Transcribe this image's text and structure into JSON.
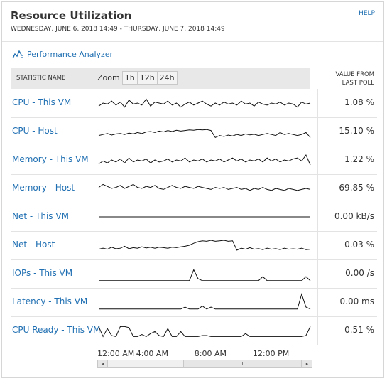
{
  "header": {
    "title": "Resource Utilization",
    "subtitle": "WEDNESDAY, JUNE 6, 2018 14:49 - THURSDAY, JUNE 7, 2018 14:49",
    "help": "HELP"
  },
  "perf_link": "Performance Analyzer",
  "table_header": {
    "statistic": "STATISTIC NAME",
    "zoom_label": "Zoom",
    "zoom_options": [
      "1h",
      "12h",
      "24h"
    ],
    "value_line1": "VALUE FROM",
    "value_line2": "LAST POLL"
  },
  "rows": [
    {
      "label": "CPU - This VM",
      "value": "1.08 %",
      "series": [
        0.35,
        0.5,
        0.45,
        0.6,
        0.4,
        0.55,
        0.3,
        0.65,
        0.45,
        0.5,
        0.4,
        0.7,
        0.35,
        0.55,
        0.5,
        0.45,
        0.6,
        0.4,
        0.5,
        0.3,
        0.45,
        0.55,
        0.4,
        0.5,
        0.6,
        0.45,
        0.35,
        0.5,
        0.4,
        0.55,
        0.45,
        0.5,
        0.4,
        0.6,
        0.45,
        0.5,
        0.35,
        0.55,
        0.45,
        0.4,
        0.5,
        0.45,
        0.55,
        0.4,
        0.5,
        0.45,
        0.3,
        0.55,
        0.45,
        0.5
      ]
    },
    {
      "label": "CPU - Host",
      "value": "15.10 %",
      "series": [
        0.3,
        0.35,
        0.4,
        0.32,
        0.38,
        0.4,
        0.35,
        0.42,
        0.38,
        0.45,
        0.4,
        0.48,
        0.5,
        0.45,
        0.52,
        0.48,
        0.55,
        0.5,
        0.56,
        0.52,
        0.55,
        0.58,
        0.56,
        0.6,
        0.58,
        0.6,
        0.55,
        0.2,
        0.3,
        0.25,
        0.32,
        0.28,
        0.35,
        0.3,
        0.38,
        0.33,
        0.36,
        0.3,
        0.35,
        0.4,
        0.35,
        0.3,
        0.45,
        0.35,
        0.4,
        0.35,
        0.3,
        0.35,
        0.45,
        0.2
      ]
    },
    {
      "label": "Memory - This VM",
      "value": "1.22 %",
      "series": [
        0.3,
        0.45,
        0.35,
        0.5,
        0.4,
        0.55,
        0.35,
        0.6,
        0.4,
        0.5,
        0.45,
        0.55,
        0.35,
        0.5,
        0.4,
        0.45,
        0.55,
        0.4,
        0.5,
        0.45,
        0.6,
        0.4,
        0.5,
        0.45,
        0.55,
        0.4,
        0.5,
        0.45,
        0.55,
        0.4,
        0.5,
        0.6,
        0.45,
        0.55,
        0.4,
        0.5,
        0.45,
        0.55,
        0.4,
        0.6,
        0.45,
        0.55,
        0.4,
        0.5,
        0.45,
        0.55,
        0.6,
        0.45,
        0.75,
        0.25
      ]
    },
    {
      "label": "Memory - Host",
      "value": "69.85 %",
      "series": [
        0.55,
        0.7,
        0.6,
        0.5,
        0.55,
        0.65,
        0.5,
        0.6,
        0.7,
        0.55,
        0.5,
        0.6,
        0.55,
        0.65,
        0.5,
        0.45,
        0.55,
        0.65,
        0.55,
        0.5,
        0.6,
        0.55,
        0.5,
        0.6,
        0.55,
        0.5,
        0.45,
        0.55,
        0.5,
        0.55,
        0.45,
        0.5,
        0.55,
        0.45,
        0.5,
        0.4,
        0.5,
        0.45,
        0.55,
        0.45,
        0.4,
        0.5,
        0.45,
        0.4,
        0.5,
        0.45,
        0.4,
        0.45,
        0.5,
        0.45
      ]
    },
    {
      "label": "Net - This VM",
      "value": "0.00 kB/s",
      "series": [
        0.5,
        0.5,
        0.5,
        0.5,
        0.5,
        0.5,
        0.5,
        0.5,
        0.5,
        0.5,
        0.5,
        0.5,
        0.5,
        0.5,
        0.5,
        0.5,
        0.5,
        0.5,
        0.5,
        0.5,
        0.5,
        0.5,
        0.5,
        0.5,
        0.5,
        0.5,
        0.5,
        0.5,
        0.5,
        0.5,
        0.5,
        0.5,
        0.5,
        0.5,
        0.5,
        0.5,
        0.5,
        0.5,
        0.5,
        0.5,
        0.5,
        0.5,
        0.5,
        0.5,
        0.5,
        0.5,
        0.5,
        0.5,
        0.5,
        0.5
      ]
    },
    {
      "label": "Net - Host",
      "value": "0.03 %",
      "series": [
        0.3,
        0.35,
        0.3,
        0.4,
        0.32,
        0.35,
        0.45,
        0.33,
        0.38,
        0.35,
        0.42,
        0.36,
        0.4,
        0.35,
        0.4,
        0.38,
        0.35,
        0.4,
        0.38,
        0.42,
        0.45,
        0.5,
        0.6,
        0.68,
        0.72,
        0.7,
        0.75,
        0.7,
        0.72,
        0.75,
        0.7,
        0.72,
        0.25,
        0.35,
        0.3,
        0.38,
        0.3,
        0.33,
        0.28,
        0.35,
        0.3,
        0.33,
        0.28,
        0.35,
        0.3,
        0.32,
        0.3,
        0.35,
        0.28,
        0.3
      ]
    },
    {
      "label": "IOPs - This VM",
      "value": "0.00 /s",
      "series": [
        0.15,
        0.15,
        0.15,
        0.15,
        0.15,
        0.15,
        0.15,
        0.15,
        0.15,
        0.15,
        0.15,
        0.15,
        0.15,
        0.15,
        0.15,
        0.15,
        0.15,
        0.15,
        0.15,
        0.15,
        0.15,
        0.15,
        0.7,
        0.25,
        0.15,
        0.15,
        0.15,
        0.15,
        0.15,
        0.15,
        0.15,
        0.15,
        0.15,
        0.15,
        0.15,
        0.15,
        0.15,
        0.15,
        0.35,
        0.15,
        0.15,
        0.15,
        0.15,
        0.15,
        0.15,
        0.15,
        0.15,
        0.15,
        0.35,
        0.15
      ]
    },
    {
      "label": "Latency - This VM",
      "value": "0.00 ms",
      "series": [
        0.15,
        0.15,
        0.15,
        0.15,
        0.15,
        0.15,
        0.15,
        0.15,
        0.15,
        0.15,
        0.15,
        0.15,
        0.15,
        0.15,
        0.15,
        0.15,
        0.15,
        0.15,
        0.15,
        0.15,
        0.25,
        0.15,
        0.15,
        0.15,
        0.3,
        0.15,
        0.25,
        0.15,
        0.15,
        0.15,
        0.15,
        0.15,
        0.15,
        0.15,
        0.15,
        0.15,
        0.15,
        0.15,
        0.15,
        0.15,
        0.15,
        0.15,
        0.15,
        0.15,
        0.15,
        0.15,
        0.15,
        0.9,
        0.25,
        0.15
      ]
    },
    {
      "label": "CPU Ready - This VM",
      "value": "0.51 %",
      "series": [
        0.7,
        0.2,
        0.6,
        0.25,
        0.2,
        0.7,
        0.7,
        0.65,
        0.2,
        0.2,
        0.3,
        0.2,
        0.35,
        0.45,
        0.25,
        0.2,
        0.6,
        0.2,
        0.2,
        0.45,
        0.2,
        0.2,
        0.2,
        0.2,
        0.25,
        0.25,
        0.2,
        0.2,
        0.2,
        0.2,
        0.2,
        0.2,
        0.2,
        0.2,
        0.35,
        0.2,
        0.2,
        0.2,
        0.2,
        0.2,
        0.2,
        0.2,
        0.2,
        0.2,
        0.2,
        0.2,
        0.2,
        0.2,
        0.25,
        0.7
      ]
    }
  ],
  "x_axis": {
    "labels": [
      "12:00 AM",
      "4:00 AM",
      "8:00 AM",
      "12:00 PM"
    ],
    "positions": [
      0.0,
      0.18,
      0.45,
      0.72
    ]
  },
  "scrollbar": {
    "left": "◂",
    "thumb": "III",
    "right": "▸"
  }
}
